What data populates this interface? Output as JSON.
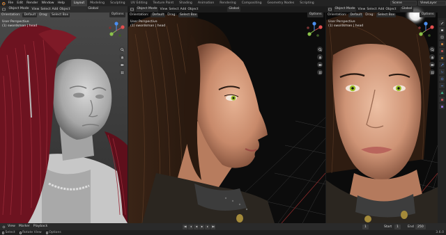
{
  "menu": [
    "File",
    "Edit",
    "Render",
    "Window",
    "Help"
  ],
  "workspaces": {
    "items": [
      "Layout",
      "Modeling",
      "Sculpting",
      "UV Editing",
      "Texture Paint",
      "Shading",
      "Animation",
      "Rendering",
      "Compositing",
      "Geometry Nodes",
      "Scripting"
    ],
    "active": "Layout"
  },
  "topbar_right": {
    "scene": "Scene",
    "view_layer": "ViewLayer"
  },
  "viewport_header": {
    "mode": "Object Mode",
    "menus": [
      "View",
      "Select",
      "Add",
      "Object"
    ],
    "transform": "Global",
    "orientation_label": "Orientation:",
    "orientation_value": "Default",
    "drag_label": "Drag:",
    "drag_value": "Select Box",
    "options": "Options"
  },
  "viewport_info": {
    "line1": "User Perspective",
    "line2": "(1) swordsman | head"
  },
  "timeline": {
    "menus": [
      "View",
      "Marker",
      "Playback"
    ],
    "current_frame": "1",
    "start_label": "Start",
    "start_value": "1",
    "end_label": "End",
    "end_value": "250"
  },
  "statusbar": {
    "select": "Select",
    "rotate": "Rotate View",
    "options": "Options",
    "version": "3.6.0"
  },
  "icons": [
    "blender-logo-icon",
    "cursor-icon",
    "move-icon",
    "rotate-icon",
    "scale-icon",
    "camera-icon",
    "grid-icon",
    "hand-icon",
    "zoom-icon",
    "play-icon"
  ],
  "colors": {
    "accent": "#4772b3",
    "axis_x": "#e24f4f",
    "axis_y": "#8bc34a",
    "axis_z": "#4b8ff0",
    "hair_red": "#7a1622",
    "clay": "#b9b9b9"
  }
}
